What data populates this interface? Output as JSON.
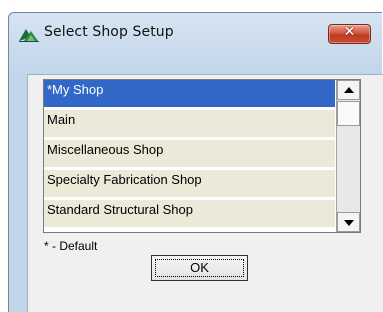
{
  "window": {
    "title": "Select Shop Setup",
    "close_label": "✕",
    "app_icon": "tekla-shop-icon"
  },
  "shop_list": {
    "items": [
      {
        "label": "*My Shop",
        "selected": true
      },
      {
        "label": "Main",
        "selected": false
      },
      {
        "label": "Miscellaneous Shop",
        "selected": false
      },
      {
        "label": "Specialty Fabrication Shop",
        "selected": false
      },
      {
        "label": "Standard Structural Shop",
        "selected": false
      }
    ]
  },
  "default_note": "* - Default",
  "ok_label": "OK",
  "colors": {
    "selection": "#3268c8",
    "row_background": "#ece9d8",
    "close_button": "#c84a31"
  }
}
